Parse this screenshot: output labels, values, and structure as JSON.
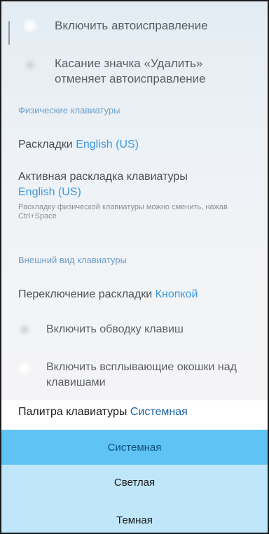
{
  "settings": {
    "autocorrect_toggle": "Включить автоисправление",
    "delete_undo_toggle": "Касание значка «Удалить» отменяет автоисправление",
    "physical_section": "Физические клавиатуры",
    "layouts_label": "Раскладки",
    "layouts_value": "English (US)",
    "active_layout_label": "Активная раскладка клавиатуры",
    "active_layout_value": "English (US)",
    "active_layout_hint": "Раскладку физической клавиатуры можно сменить, нажав Ctrl+Space",
    "appearance_section": "Внешний вид клавиатуры",
    "layout_switch_label": "Переключение раскладки",
    "layout_switch_value": "Кнопкой",
    "key_border_toggle": "Включить обводку клавиш",
    "key_popups_toggle": "Включить всплывающие окошки над клавишами",
    "palette_label": "Палитра клавиатуры",
    "palette_value": "Системная"
  },
  "palette_menu": {
    "options": [
      "Системная",
      "Светлая",
      "Темная"
    ],
    "selected": "Системная"
  },
  "colors": {
    "accent": "#3b9ae0",
    "selected_option": "#5fc4f3",
    "menu_background": "#bfe6fb"
  },
  "icons": [
    "toggle-icon"
  ]
}
